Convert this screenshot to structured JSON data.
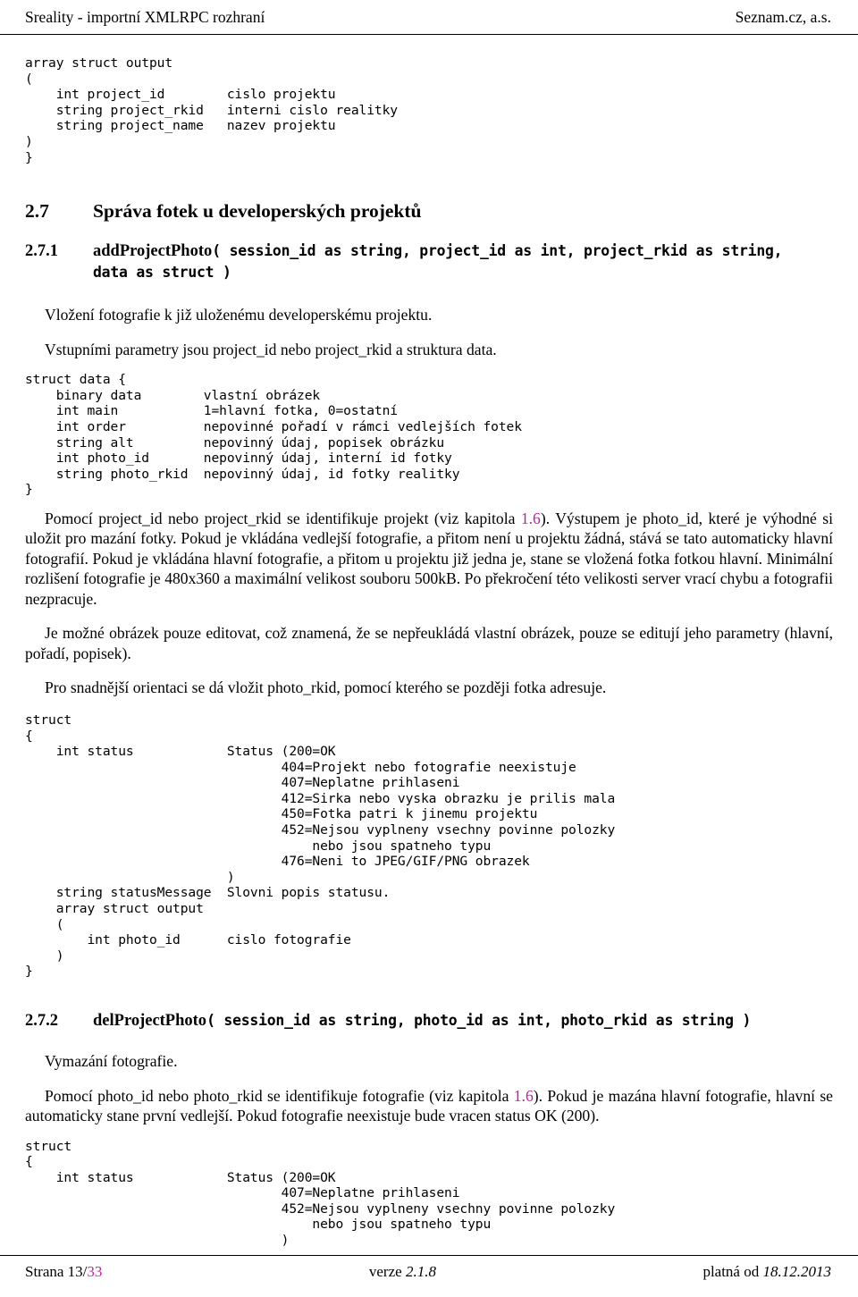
{
  "document": {
    "header_left": "Sreality - importní XMLRPC rozhraní",
    "header_right": "Seznam.cz, a.s."
  },
  "code_blocks": {
    "output_projects": "array struct output\n(\n    int project_id        cislo projektu\n    string project_rkid   interni cislo realitky\n    string project_name   nazev projektu\n)\n}",
    "struct_data": "struct data {\n    binary data        vlastní obrázek\n    int main           1=hlavní fotka, 0=ostatní\n    int order          nepovinné pořadí v rámci vedlejších fotek\n    string alt         nepovinný údaj, popisek obrázku\n    int photo_id       nepovinný údaj, interní id fotky\n    string photo_rkid  nepovinný údaj, id fotky realitky\n}",
    "add_photo_result": "struct\n{\n    int status            Status (200=OK\n                                 404=Projekt nebo fotografie neexistuje\n                                 407=Neplatne prihlaseni\n                                 412=Sirka nebo vyska obrazku je prilis mala\n                                 450=Fotka patri k jinemu projektu\n                                 452=Nejsou vyplneny vsechny povinne polozky\n                                     nebo jsou spatneho typu\n                                 476=Neni to JPEG/GIF/PNG obrazek\n                          )\n    string statusMessage  Slovni popis statusu.\n    array struct output\n    (\n        int photo_id      cislo fotografie\n    )\n}",
    "del_photo_result": "struct\n{\n    int status            Status (200=OK\n                                 407=Neplatne prihlaseni\n                                 452=Nejsou vyplneny vsechny povinne polozky\n                                     nebo jsou spatneho typu\n                                 )"
  },
  "sections": {
    "s27": {
      "number": "2.7",
      "title": "Správa fotek u developerských projektů"
    },
    "s271": {
      "number": "2.7.1",
      "fname": "addProjectPhoto",
      "sig_line1": "( session_id as string, project_id as int, project_rkid as string,",
      "sig_line2": "data as struct )",
      "p1": "Vložení fotografie k již uloženému developerskému projektu.",
      "p2": "Vstupními parametry jsou project_id nebo project_rkid a struktura data.",
      "p3_a": "Pomocí project_id nebo project_rkid se identifikuje projekt (viz kapitola ",
      "p3_link": "1.6",
      "p3_b": "). Výstupem je photo_id, které je výhodné si uložit pro mazání fotky. Pokud je vkládána vedlejší fotografie, a přitom není u projektu žádná, stává se tato automaticky hlavní fotografií. Pokud je vkládána hlavní fotografie, a přitom u projektu již jedna je, stane se vložená fotka fotkou hlavní. Minimální rozlišení fotografie je 480x360 a maximální velikost souboru 500kB. Po překročení této velikosti server vrací chybu a fotografii nezpracuje.",
      "p4": "Je možné obrázek pouze editovat, což znamená, že se nepřeukládá vlastní obrázek, pouze se editují jeho parametry (hlavní, pořadí, popisek).",
      "p5": "Pro snadnější orientaci se dá vložit photo_rkid, pomocí kterého se později fotka adresuje."
    },
    "s272": {
      "number": "2.7.2",
      "fname": "delProjectPhoto",
      "sig_line1": "( session_id as string, photo_id as int, photo_rkid as string )",
      "p1": "Vymazání fotografie.",
      "p2_a": "Pomocí photo_id nebo photo_rkid se identifikuje fotografie (viz kapitola ",
      "p2_link": "1.6",
      "p2_b": "). Pokud je mazána hlavní fotografie, hlavní se automaticky stane první vedlejší. Pokud fotografie neexistuje bude vracen status OK (200)."
    }
  },
  "footer": {
    "page_label": "Strana 13/",
    "page_total": "33",
    "version_label": "verze ",
    "version_value": "2.1.8",
    "valid_label": "platná od ",
    "valid_value": "18.12.2013"
  },
  "colors": {
    "link": "#c020a0",
    "text": "#000000",
    "background": "#ffffff"
  }
}
